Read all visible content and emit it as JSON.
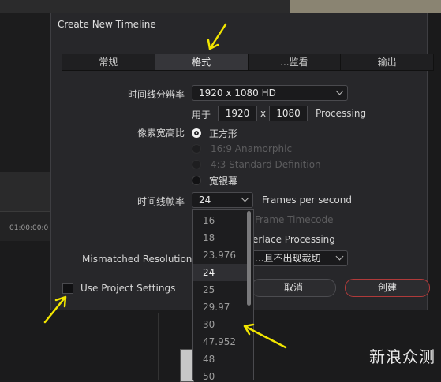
{
  "background": {
    "timecode": "01:00:00:0"
  },
  "dialog": {
    "title": "Create New Timeline",
    "tabs": [
      {
        "label": "常规",
        "active": false
      },
      {
        "label": "格式",
        "active": true
      },
      {
        "label": "...监看",
        "active": false
      },
      {
        "label": "输出",
        "active": false
      }
    ],
    "resolution": {
      "label": "时间线分辨率",
      "value": "1920 x 1080 HD",
      "for_label": "用于",
      "width": "1920",
      "x": "x",
      "height": "1080",
      "processing": "Processing"
    },
    "pixel_aspect": {
      "label": "像素宽高比",
      "options": [
        {
          "label": "正方形",
          "state": "selected"
        },
        {
          "label": "16:9 Anamorphic",
          "state": "disabled"
        },
        {
          "label": "4:3 Standard Definition",
          "state": "disabled"
        },
        {
          "label": "宽银幕",
          "state": "normal"
        }
      ]
    },
    "frame_rate": {
      "label": "时间线帧率",
      "value": "24",
      "suffix": "Frames per second"
    },
    "partial": {
      "drop_frame": "Frame Timecode",
      "interlace": "erlace Processing"
    },
    "mismatched": {
      "label": "Mismatched Resolution",
      "value": "...且不出现裁切"
    },
    "use_project_settings": "Use Project Settings",
    "cancel_label": "取消",
    "create_label": "创建"
  },
  "frame_rate_dropdown": {
    "options": [
      "16",
      "18",
      "23.976",
      "24",
      "25",
      "29.97",
      "30",
      "47.952",
      "48",
      "50"
    ],
    "selected": "24"
  },
  "colors": {
    "annotation_arrow": "#f2e600",
    "create_border": "#b03a3a"
  },
  "watermark": "新浪众测"
}
